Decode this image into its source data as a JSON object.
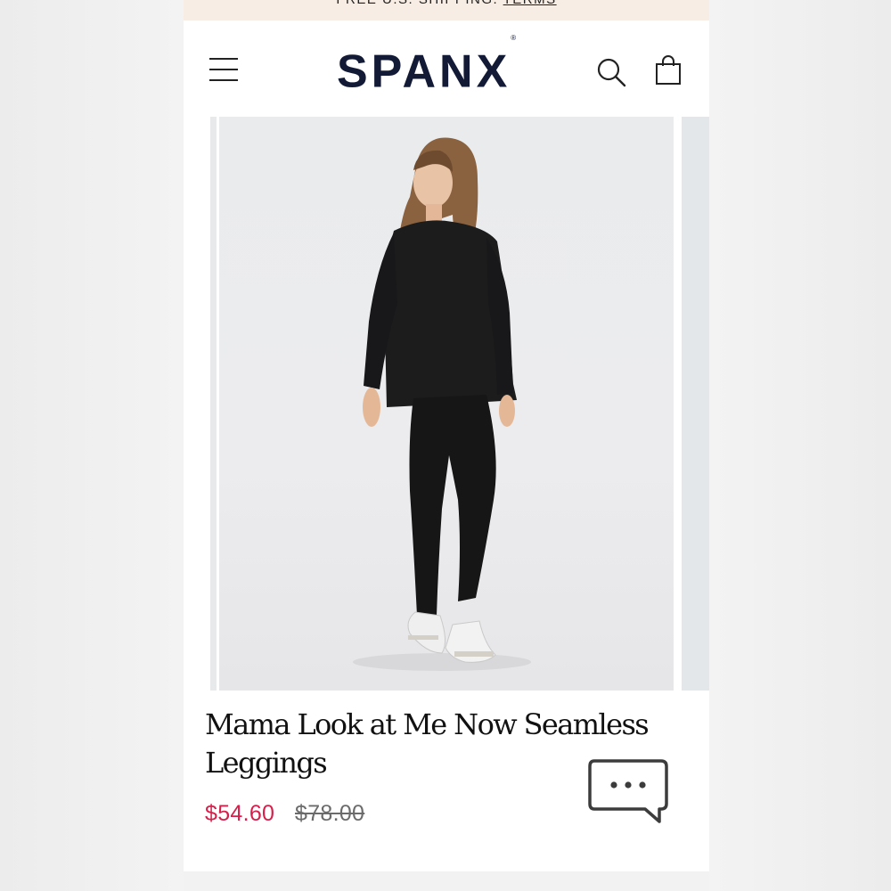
{
  "promo_bar": {
    "text": "FREE U.S. SHIPPING. ",
    "link_label": "TERMS"
  },
  "header": {
    "logo_text": "SPANX",
    "logo_mark": "®",
    "icons": [
      "menu-icon",
      "search-icon",
      "shopping-bag-icon"
    ]
  },
  "product": {
    "title": "Mama Look at Me Now Seamless Leggings",
    "sale_price": "$54.60",
    "original_price": "$78.00"
  },
  "chat": {
    "icon": "chat-bubble-icon"
  },
  "colors": {
    "promo_background": "#f8ede4",
    "logo": "#131a35",
    "sale_price": "#d6204b",
    "original_price": "#6b6b6b"
  }
}
